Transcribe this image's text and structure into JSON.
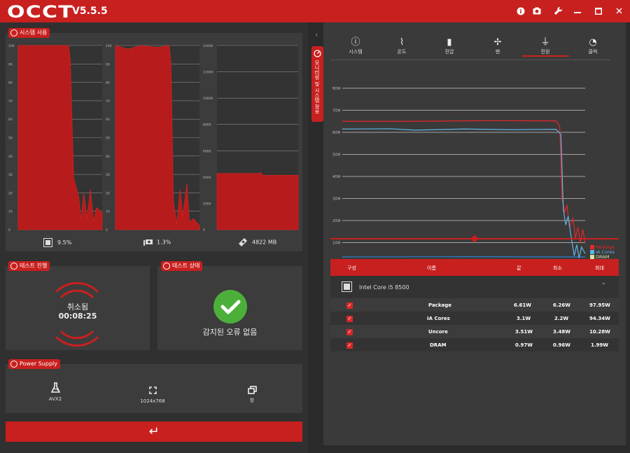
{
  "app": {
    "logo": "OCCT",
    "version": "V5.5.5"
  },
  "titlebar_icons": [
    "info-icon",
    "camera-icon",
    "wrench-icon",
    "minimize-icon",
    "maximize-icon",
    "close-icon"
  ],
  "system_usage": {
    "tag": "시스템 사용",
    "cpu": {
      "value": "9.5%",
      "ticks": [
        "100",
        "90",
        "80",
        "70",
        "60",
        "50",
        "40",
        "30",
        "20",
        "10",
        "0"
      ]
    },
    "gpu": {
      "value": "1.3%",
      "ticks": [
        "100",
        "90",
        "80",
        "70",
        "60",
        "50",
        "40",
        "30",
        "20",
        "10",
        "0"
      ]
    },
    "mem": {
      "value": "4822 MB",
      "ticks": [
        "14000",
        "12000",
        "10000",
        "8000",
        "6000",
        "4000",
        "2000",
        "0"
      ]
    }
  },
  "test_progress": {
    "tag": "테스트 진행",
    "status": "취소됨",
    "time": "00:08:25"
  },
  "test_status": {
    "tag": "테스트 상태",
    "message": "감지된 오류 없음"
  },
  "power_supply": {
    "tag": "Power Supply",
    "options": [
      {
        "icon": "flask-icon",
        "label": "AVX2"
      },
      {
        "icon": "fullscreen-icon",
        "label": "1024x768"
      },
      {
        "icon": "window-icon",
        "label": "창"
      }
    ]
  },
  "enter_button": "↵",
  "collapse_arrow": "‹",
  "vertical_tab": "모니터링 및 시스템 정보",
  "right_tabs": [
    {
      "icon": "ⓘ",
      "label": "시스템"
    },
    {
      "icon": "⌇",
      "label": "온도"
    },
    {
      "icon": "▮",
      "label": "전압"
    },
    {
      "icon": "✢",
      "label": "팬"
    },
    {
      "icon": "⏚",
      "label": "전원",
      "active": true
    },
    {
      "icon": "◔",
      "label": "클럭"
    }
  ],
  "chart_data": {
    "type": "line",
    "y_ticks": [
      "80W",
      "70W",
      "60W",
      "50W",
      "40W",
      "30W",
      "20W",
      "10W",
      "0W"
    ],
    "ylim": [
      0,
      80
    ],
    "series": [
      {
        "name": "Package",
        "color": "#e8272a"
      },
      {
        "name": "IA Cores",
        "color": "#5fb4e6"
      },
      {
        "name": "DRAM",
        "color": "#d9e6a0"
      }
    ]
  },
  "table": {
    "headers": [
      "구성",
      "이름",
      "값",
      "최소",
      "최대"
    ],
    "device": "Intel Core i5 8500",
    "rows": [
      {
        "name": "Package",
        "value": "6.61W",
        "min": "6.26W",
        "max": "97.95W"
      },
      {
        "name": "IA Cores",
        "value": "3.1W",
        "min": "2.2W",
        "max": "94.34W"
      },
      {
        "name": "Uncore",
        "value": "3.51W",
        "min": "3.48W",
        "max": "10.28W"
      },
      {
        "name": "DRAM",
        "value": "0.97W",
        "min": "0.96W",
        "max": "1.99W"
      }
    ],
    "check": "✓",
    "collapse": "⌃"
  }
}
